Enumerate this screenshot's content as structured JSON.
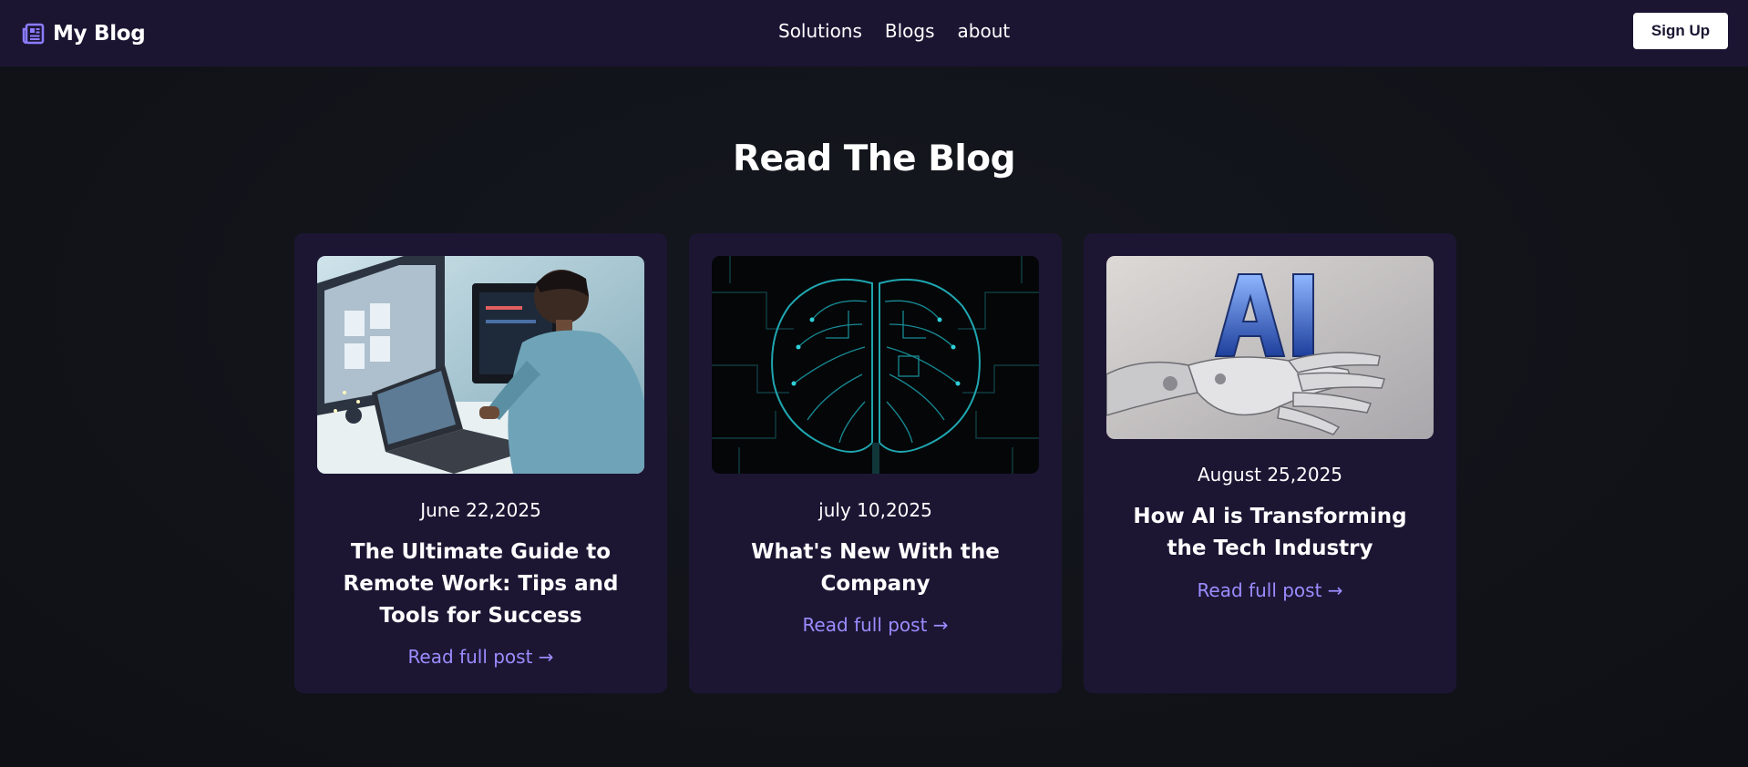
{
  "brand": {
    "name": "My Blog",
    "icon": "newspaper-icon",
    "accent": "#8b7cff"
  },
  "nav": {
    "links": [
      "Solutions",
      "Blogs",
      "about"
    ]
  },
  "signup": {
    "label": "Sign Up"
  },
  "section": {
    "title": "Read The Blog"
  },
  "posts": [
    {
      "date": "June 22,2025",
      "title": "The Ultimate Guide to Remote Work: Tips and Tools for Success",
      "link": "Read full post →",
      "image": "man-working-at-computer"
    },
    {
      "date": "july 10,2025",
      "title": "What's New With the Company",
      "link": "Read full post →",
      "image": "circuit-brain"
    },
    {
      "date": "August 25,2025",
      "title": "How AI is Transforming the Tech Industry",
      "link": "Read full post →",
      "image": "robot-hand-ai"
    }
  ],
  "colors": {
    "navbar": "#1b1532",
    "card": "#1c1633",
    "link": "#9b8cff",
    "background": "#111319"
  }
}
